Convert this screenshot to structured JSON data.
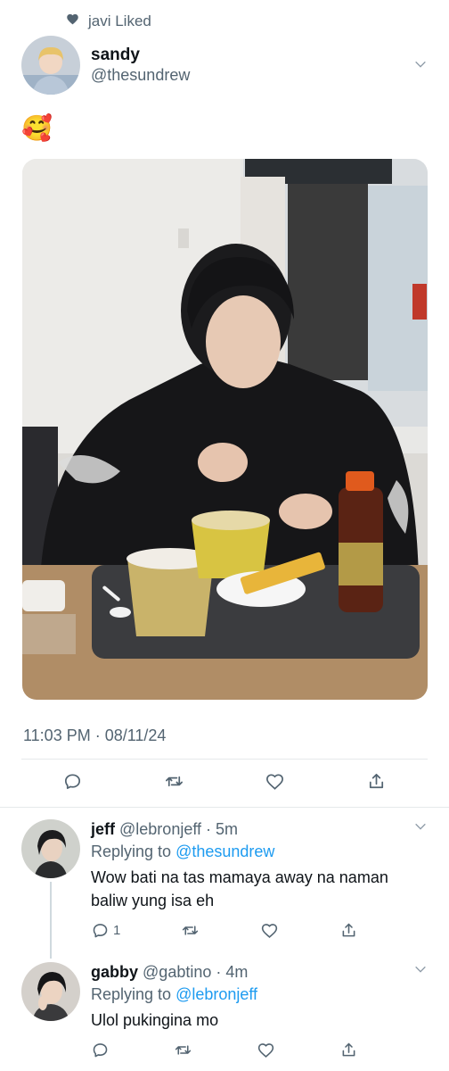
{
  "social_context": {
    "icon": "heart-icon",
    "text": "javi Liked"
  },
  "tweet": {
    "display_name": "sandy",
    "handle": "@thesundrew",
    "text": "🥰",
    "media_icon": "photo",
    "timestamp": "11:03 PM · 08/11/24"
  },
  "replies": [
    {
      "name": "jeff",
      "handle_time": "@lebronjeff · 5m",
      "replying_prefix": "Replying to ",
      "replying_to": "@thesundrew",
      "text": "Wow bati na tas mamaya away na naman baliw yung isa eh",
      "reply_count": "1"
    },
    {
      "name": "gabby",
      "handle_time": "@gabtino · 4m",
      "replying_prefix": "Replying to ",
      "replying_to": "@lebronjeff",
      "text": "Ulol pukingina mo",
      "reply_count": ""
    }
  ],
  "colors": {
    "link": "#1d9bf0",
    "secondary": "#536471",
    "text": "#0f1419"
  }
}
